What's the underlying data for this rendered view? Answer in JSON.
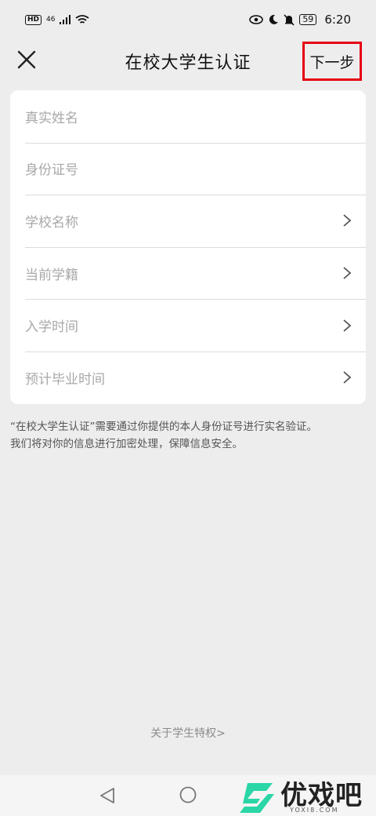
{
  "status_bar": {
    "left_badge": "HD",
    "network": "46",
    "battery": "59",
    "time": "6:20"
  },
  "header": {
    "title": "在校大学生认证",
    "next_label": "下一步",
    "next_highlight_color": "#e60012"
  },
  "form": {
    "rows": [
      {
        "label": "真实姓名",
        "has_arrow": false
      },
      {
        "label": "身份证号",
        "has_arrow": false
      },
      {
        "label": "学校名称",
        "has_arrow": true
      },
      {
        "label": "当前学籍",
        "has_arrow": true
      },
      {
        "label": "入学时间",
        "has_arrow": true
      },
      {
        "label": "预计毕业时间",
        "has_arrow": true
      }
    ]
  },
  "note": {
    "line1": "“在校大学生认证”需要通过你提供的本人身份证号进行实名验证。",
    "line2": "我们将对你的信息进行加密处理，保障信息安全。"
  },
  "footer": {
    "about_link": "关于学生特权>"
  },
  "watermark": {
    "text": "优戏吧",
    "sub": "YOXI8.COM",
    "color": "#2bd6a6"
  },
  "icons": [
    "close-icon",
    "chevron-right-icon",
    "nav-back-icon",
    "nav-home-icon",
    "eye-icon",
    "moon-icon",
    "bell-off-icon",
    "wifi-icon",
    "signal-icon"
  ]
}
